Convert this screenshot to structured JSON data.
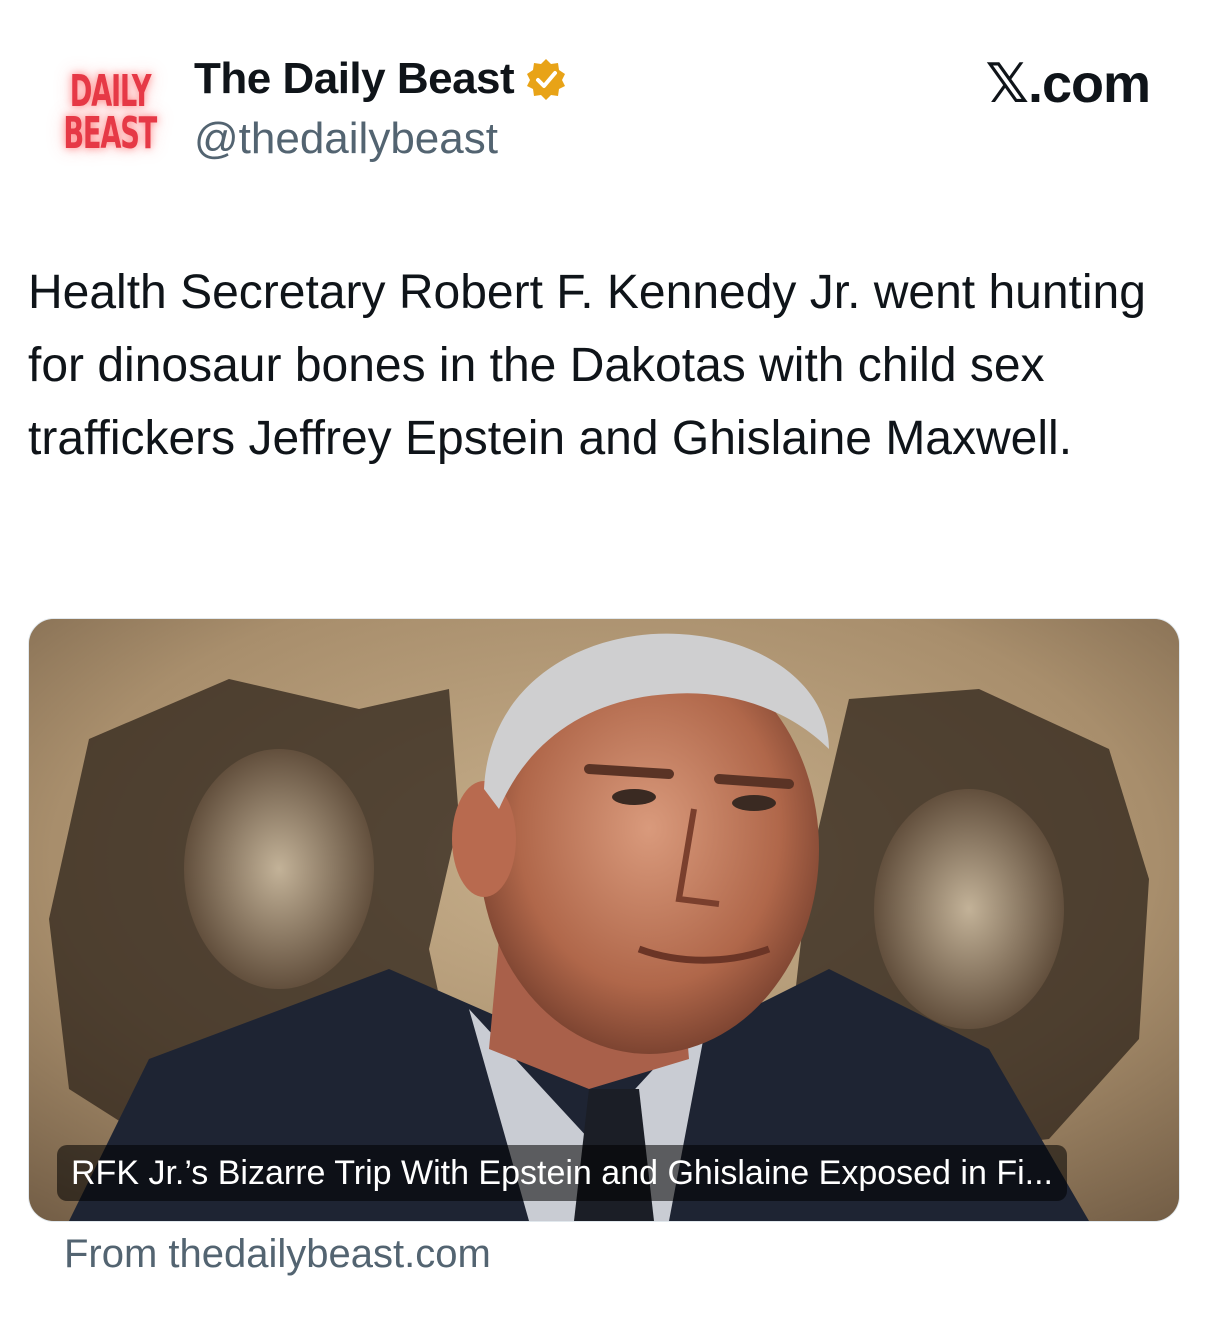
{
  "header": {
    "logo_line1": "DAILY",
    "logo_line2": "BEAST",
    "account_name": "The Daily Beast",
    "handle": "@thedailybeast",
    "site_label": "𝕏.com"
  },
  "tweet": {
    "text": "Health Secretary Robert F. Kennedy Jr. went hunting for dinosaur bones in the Dakotas with child sex traffickers Jeffrey Epstein and Ghislaine Maxwell."
  },
  "card": {
    "image_icon": "article-image",
    "title": "RFK Jr.’s Bizarre Trip With Epstein and Ghislaine Exposed in Fi...",
    "source": "From thedailybeast.com"
  },
  "colors": {
    "logo_red": "#e63946",
    "verified_gold": "#e8a317",
    "muted_text": "#536471",
    "primary_text": "#0f1419"
  }
}
